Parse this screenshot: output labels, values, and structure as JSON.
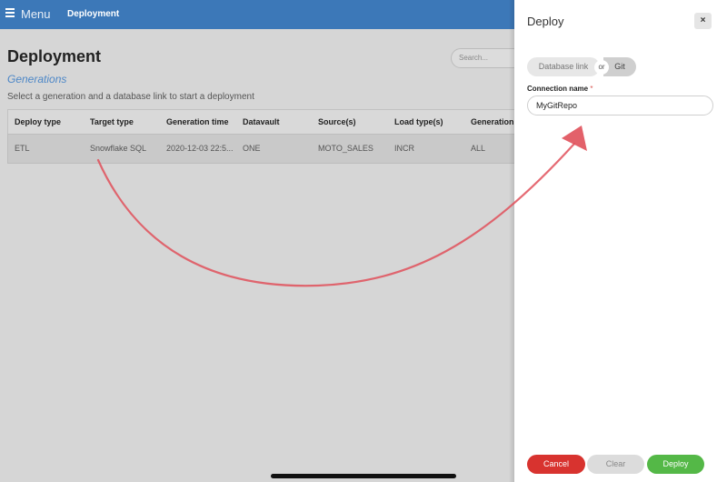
{
  "topbar": {
    "menu_label": "Menu",
    "breadcrumb": "Deployment"
  },
  "main": {
    "title": "Deployment",
    "section_link": "Generations",
    "instructions": "Select a generation and a database link to start a deployment",
    "search_placeholder": "Search...",
    "table": {
      "columns": [
        "Deploy type",
        "Target type",
        "Generation time",
        "Datavault",
        "Source(s)",
        "Load type(s)",
        "Generation"
      ],
      "rows": [
        [
          "ETL",
          "Snowflake SQL",
          "2020-12-03 22:5...",
          "ONE",
          "MOTO_SALES",
          "INCR",
          "ALL"
        ]
      ]
    }
  },
  "panel": {
    "title": "Deploy",
    "close_label": "×",
    "toggle": {
      "option_a": "Database link",
      "or": "or",
      "option_b": "Git",
      "selected": "Git"
    },
    "connection_label": "Connection name",
    "required_mark": "*",
    "connection_value": "MyGitRepo",
    "buttons": {
      "cancel": "Cancel",
      "clear": "Clear",
      "deploy": "Deploy"
    }
  },
  "colors": {
    "topbar": "#3c78b8",
    "cancel": "#d8332f",
    "deploy": "#54b847",
    "annotation_arrow": "#e0505a"
  }
}
